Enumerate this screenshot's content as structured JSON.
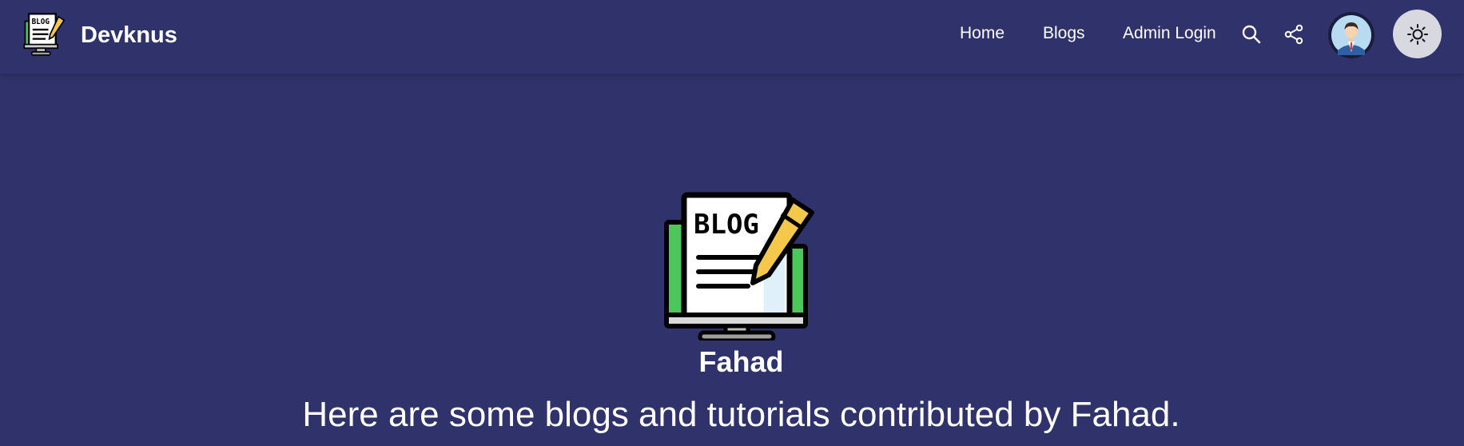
{
  "header": {
    "brand_name": "Devknus",
    "logo_icon": "blog-monitor-icon",
    "nav": {
      "home": "Home",
      "blogs": "Blogs",
      "admin_login": "Admin Login"
    },
    "icons": {
      "search": "search-icon",
      "share": "share-icon",
      "avatar": "user-avatar",
      "theme": "sun-icon"
    }
  },
  "hero": {
    "logo_icon": "blog-monitor-icon",
    "logo_text": "BLOG",
    "author_name": "Fahad",
    "subtitle": "Here are some blogs and tutorials contributed by Fahad."
  },
  "colors": {
    "background": "#30326b",
    "text": "#ffffff",
    "toggle_bg": "#d8d8e0",
    "logo_green": "#4cc75a",
    "logo_pencil": "#f5c84c"
  }
}
